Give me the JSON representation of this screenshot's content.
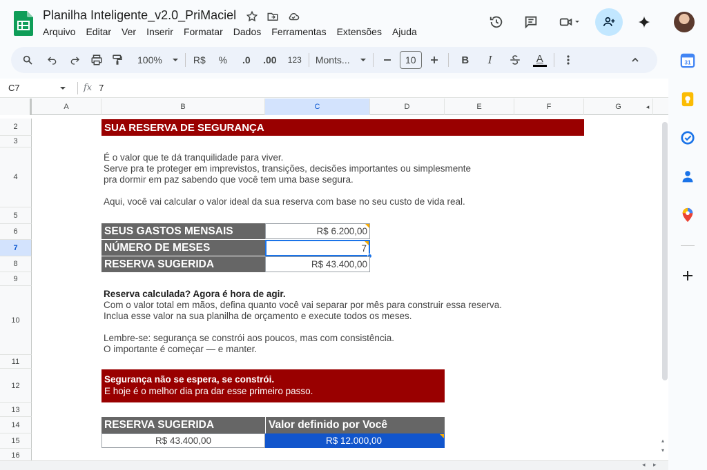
{
  "app": {
    "doc_title": "Planilha Inteligente_v2.0_PriMaciel",
    "menu": [
      "Arquivo",
      "Editar",
      "Ver",
      "Inserir",
      "Formatar",
      "Dados",
      "Ferramentas",
      "Extensões",
      "Ajuda"
    ]
  },
  "toolbar": {
    "zoom": "100%",
    "currency": "R$",
    "percent": "%",
    "dec_decrease": ".0",
    "dec_increase": ".00",
    "number_format": "123",
    "font": "Monts...",
    "font_size": "10",
    "bold": "B",
    "italic": "I",
    "text_color": "A"
  },
  "formula_bar": {
    "cell_ref": "C7",
    "fx": "fx",
    "value": "7"
  },
  "columns": [
    "A",
    "B",
    "C",
    "D",
    "E",
    "F",
    "G"
  ],
  "rows": [
    "2",
    "3",
    "4",
    "5",
    "6",
    "7",
    "8",
    "9",
    "10",
    "11",
    "12",
    "13",
    "14",
    "15",
    "16"
  ],
  "sheet": {
    "header_banner": "SUA RESERVA DE SEGURANÇA",
    "intro_lines": [
      "É o valor que te dá tranquilidade para viver.",
      "Serve pra te proteger em imprevistos, transições, decisões importantes ou simplesmente",
      "pra dormir em paz sabendo que você tem uma base segura.",
      "",
      "Aqui, você vai calcular o valor ideal da sua reserva com base no seu custo de vida real."
    ],
    "calc": {
      "gastos_label": "SEUS GASTOS MENSAIS",
      "gastos_value": "R$ 6.200,00",
      "meses_label": "NÚMERO DE MESES",
      "meses_value": "7",
      "reserva_label": "RESERVA SUGERIDA",
      "reserva_value": "R$ 43.400,00"
    },
    "action_title": "Reserva calculada? Agora é hora de agir.",
    "action_lines": [
      "Com o valor total em mãos, defina quanto você vai separar por mês para construir essa reserva.",
      "Inclua esse valor na sua planilha de orçamento e execute todos os meses.",
      "",
      "Lembre-se: segurança se constrói aos poucos, mas com consistência.",
      "O importante é começar — e manter."
    ],
    "callout_title": "Segurança não se espera, se constrói.",
    "callout_text": "E hoje é o melhor dia pra dar esse primeiro passo.",
    "summary": {
      "col1_header": "RESERVA SUGERIDA",
      "col2_header": "Valor definido por Você",
      "col1_value": "R$ 43.400,00",
      "col2_value": "R$ 12.000,00"
    }
  },
  "colors": {
    "banner": "#990000",
    "label_gray": "#666666",
    "selection_blue": "#1a73e8",
    "value_blue": "#1155cc",
    "sheets_green": "#0f9d58"
  }
}
